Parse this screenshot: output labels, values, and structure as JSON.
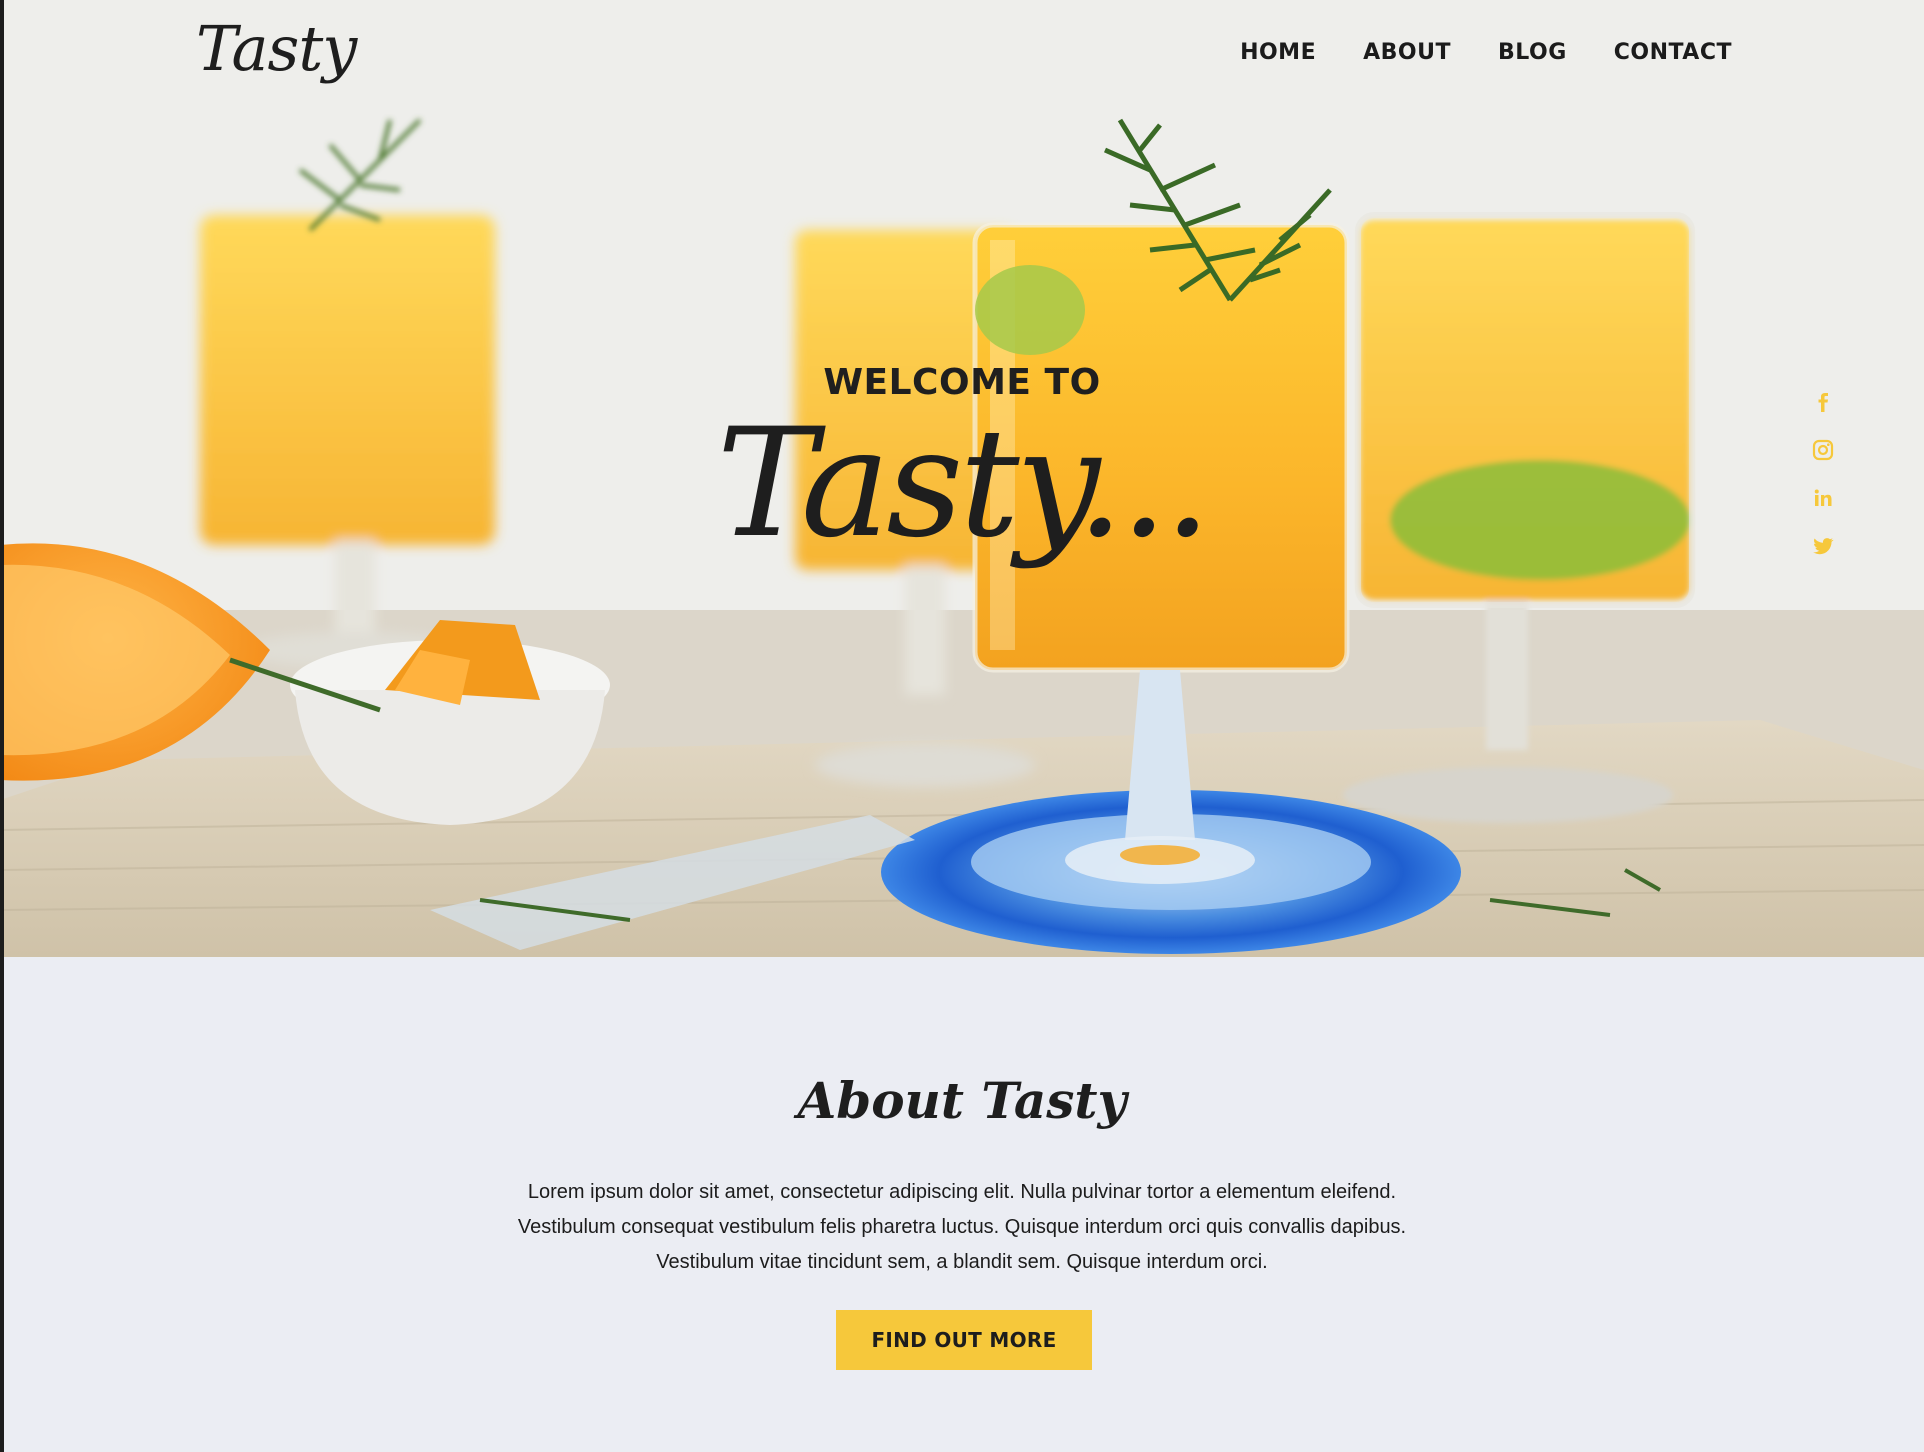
{
  "header": {
    "logo": "Tasty",
    "nav": [
      "HOME",
      "ABOUT",
      "BLOG",
      "CONTACT"
    ]
  },
  "hero": {
    "welcome": "WELCOME TO",
    "title": "Tasty..."
  },
  "social": {
    "icons": [
      "facebook-icon",
      "instagram-icon",
      "linkedin-icon",
      "twitter-icon"
    ],
    "color": "#f6c83b"
  },
  "about": {
    "title": "About Tasty",
    "lines": [
      "Lorem ipsum dolor sit amet, consectetur adipiscing elit. Nulla pulvinar tortor a elementum eleifend.",
      "Vestibulum consequat vestibulum felis pharetra luctus. Quisque interdum orci quis convallis dapibus.",
      "Vestibulum vitae tincidunt sem, a blandit sem. Quisque interdum orci."
    ],
    "button": "FIND OUT MORE"
  },
  "colors": {
    "accent": "#f6c83b",
    "text": "#1d1d1d",
    "section_bg": "#ebedf3"
  }
}
